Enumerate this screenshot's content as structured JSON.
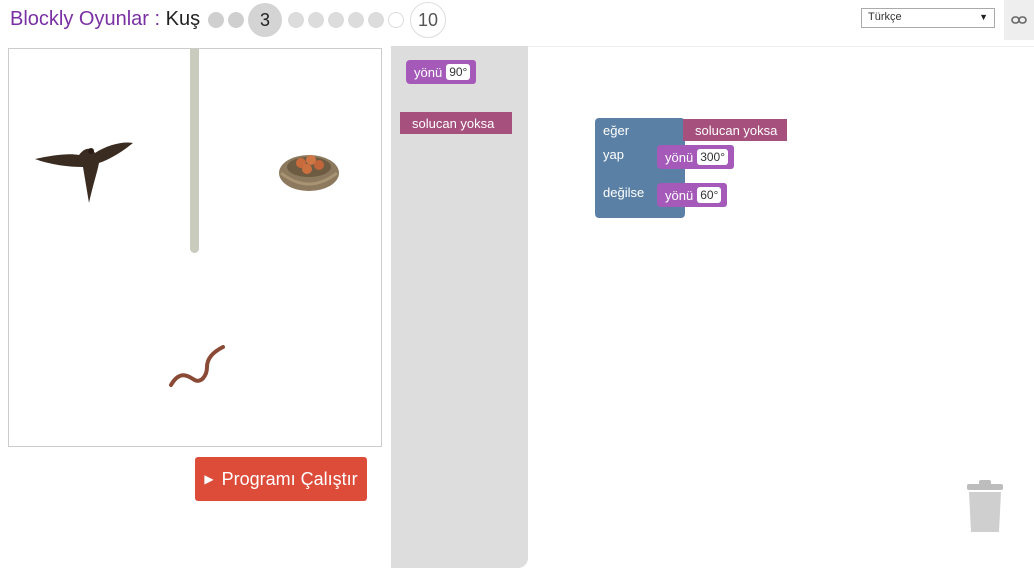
{
  "header": {
    "app_title": "Blockly Oyunlar : ",
    "level_name": "Kuş",
    "current_level": "3",
    "last_level": "10",
    "language": "Türkçe"
  },
  "run_button": {
    "label": "Programı Çalıştır"
  },
  "toolbox": {
    "heading_block": {
      "label": "yönü",
      "value": "90°"
    },
    "condition_block": {
      "label": "solucan yoksa"
    }
  },
  "workspace": {
    "if_label": "eğer",
    "do_label": "yap",
    "else_label": "değilse",
    "condition": "solucan yoksa",
    "do_block": {
      "label": "yönü",
      "value": "300°"
    },
    "else_block": {
      "label": "yönü",
      "value": "60°"
    }
  }
}
